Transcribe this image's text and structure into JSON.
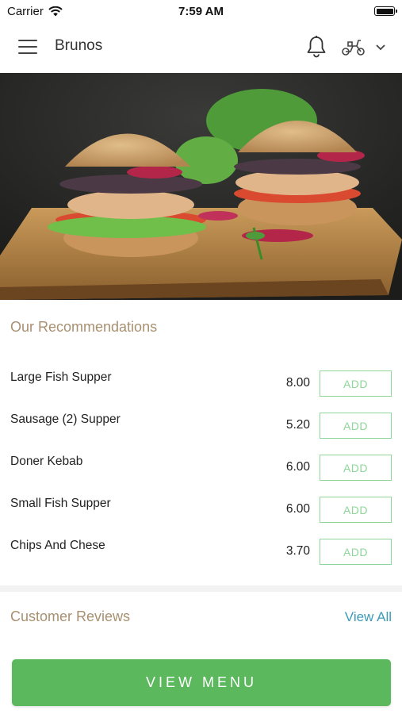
{
  "status_bar": {
    "carrier": "Carrier",
    "time": "7:59 AM"
  },
  "header": {
    "title": "Brunos",
    "menu_icon": "hamburger-icon",
    "bell_icon": "bell-icon",
    "mode_icon": "scooter-icon",
    "dropdown_icon": "chevron-down-icon"
  },
  "hero": {
    "image": "burgers-on-cutting-board-photo"
  },
  "recommendations": {
    "title": "Our Recommendations",
    "items": [
      {
        "name": "Large Fish Supper",
        "price": "8.00",
        "action": "ADD"
      },
      {
        "name": "Sausage (2) Supper",
        "price": "5.20",
        "action": "ADD"
      },
      {
        "name": "Doner Kebab",
        "price": "6.00",
        "action": "ADD"
      },
      {
        "name": "Small Fish Supper",
        "price": "6.00",
        "action": "ADD"
      },
      {
        "name": "Chips And Chese",
        "price": "3.70",
        "action": "ADD"
      }
    ]
  },
  "reviews": {
    "title": "Customer Reviews",
    "view_all": "View All"
  },
  "cta": {
    "label": "VIEW MENU"
  },
  "colors": {
    "accent_green": "#5cb85c",
    "add_border": "#8ed69a",
    "section_title": "#a89070",
    "link": "#3b9bb8"
  }
}
